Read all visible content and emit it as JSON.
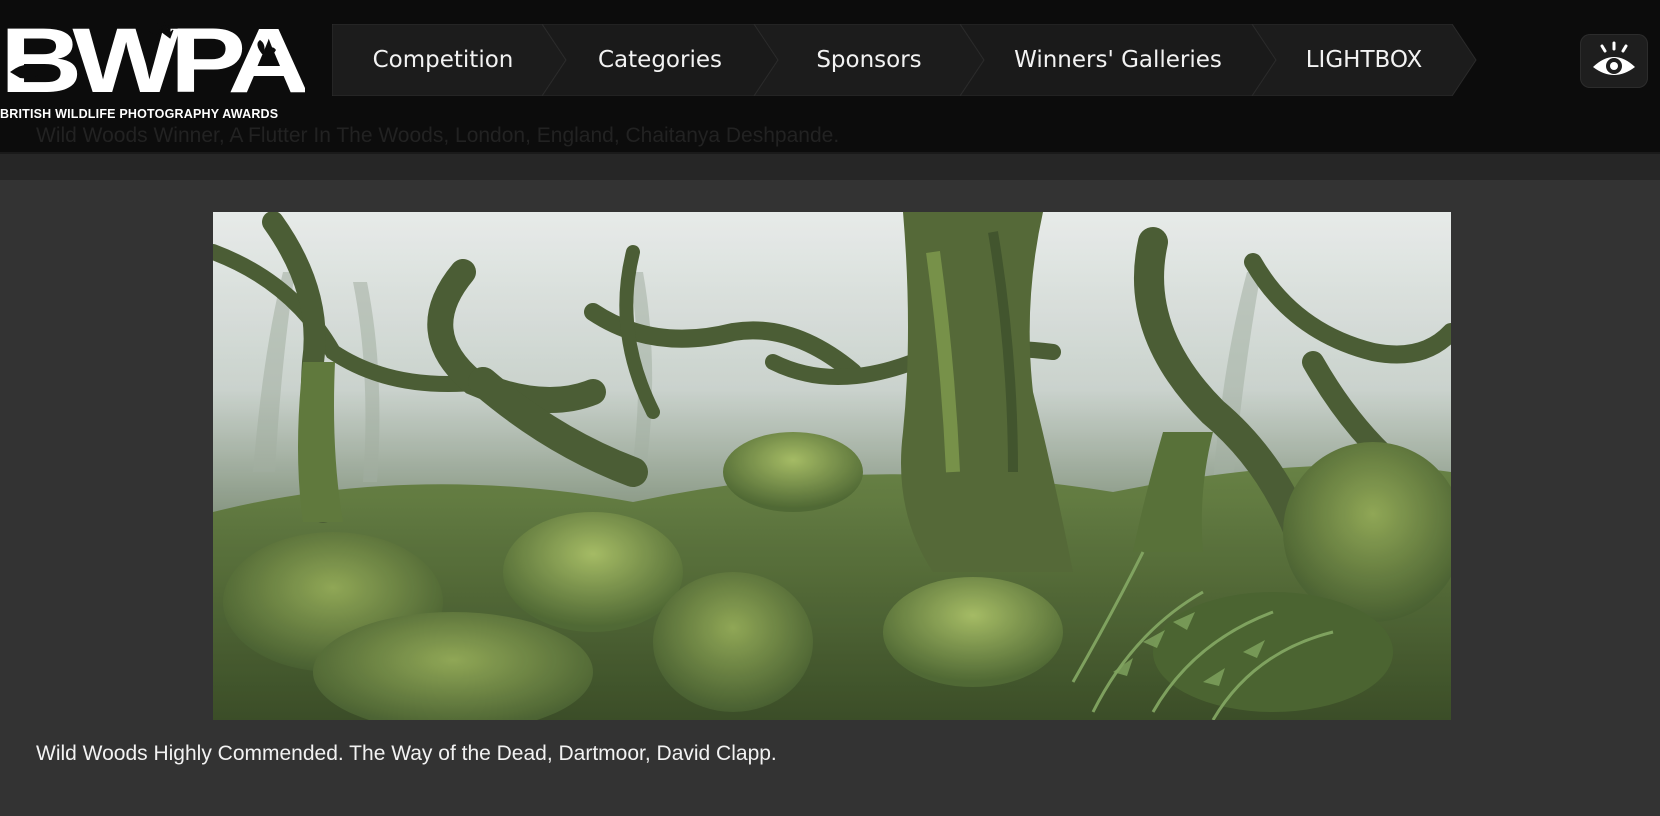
{
  "brand": {
    "logo_text": "BWPA",
    "subtitle": "BRITISH WILDLIFE PHOTOGRAPHY AWARDS"
  },
  "nav": {
    "items": [
      {
        "label": "Competition"
      },
      {
        "label": "Categories"
      },
      {
        "label": "Sponsors"
      },
      {
        "label": "Winners' Galleries"
      },
      {
        "label": "LIGHTBOX"
      }
    ]
  },
  "lightbox_button": {
    "icon": "eye-icon"
  },
  "previous_caption": "Wild Woods Winner, A Flutter In The Woods, London, England, Chaitanya Deshpande.",
  "gallery": {
    "caption": "Wild Woods Highly Commended. The Way of the Dead, Dartmoor, David Clapp."
  },
  "colors": {
    "page_bg": "#333333",
    "header_bg": "#0c0c0c",
    "nav_bg": "#1c1c1c",
    "text": "#f2f2f2"
  }
}
